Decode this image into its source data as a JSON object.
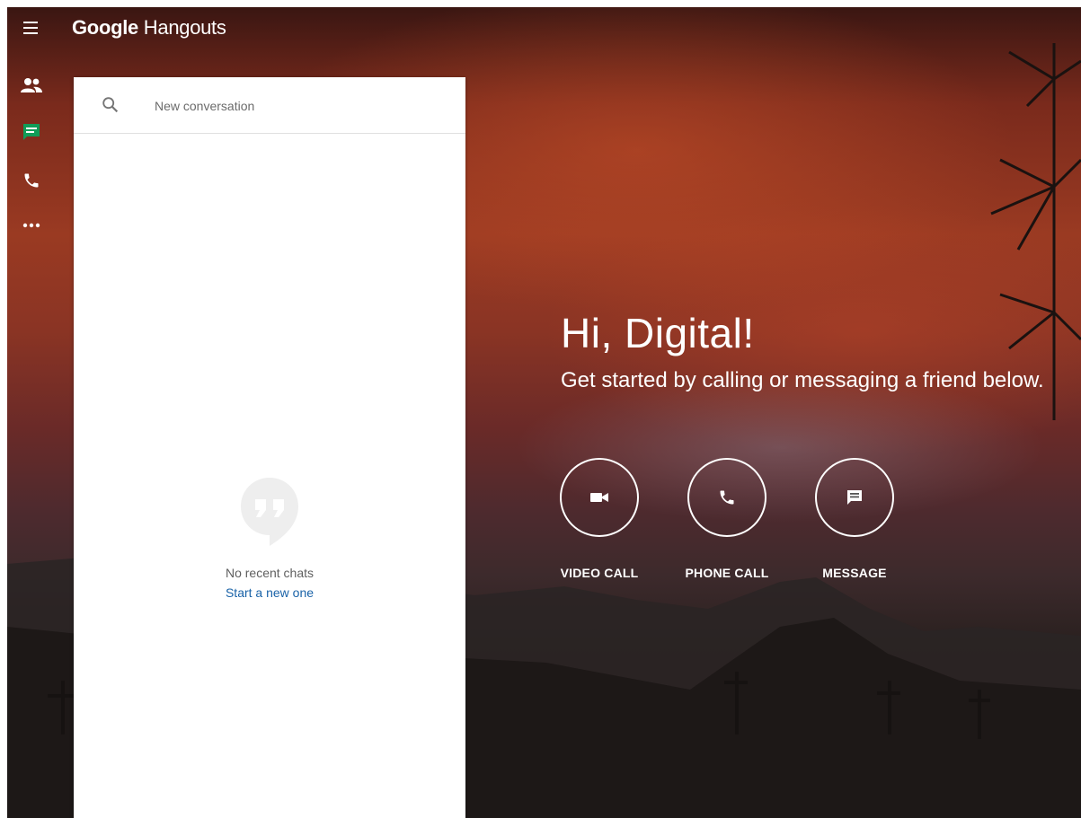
{
  "app": {
    "brand_google": "Google",
    "brand_product": "Hangouts"
  },
  "rail": {
    "items": [
      {
        "icon": "contacts-icon"
      },
      {
        "icon": "chat-icon",
        "active": true
      },
      {
        "icon": "phone-icon"
      },
      {
        "icon": "more-icon"
      }
    ],
    "active_color": "#0f9d58"
  },
  "search": {
    "placeholder": "New conversation",
    "value": ""
  },
  "empty_state": {
    "icon": "quote-bubble-icon",
    "text": "No recent chats",
    "link": "Start a new one"
  },
  "greeting": {
    "title": "Hi, Digital!",
    "subtitle": "Get started by calling or messaging a friend below."
  },
  "actions": [
    {
      "label": "VIDEO CALL",
      "icon": "video-camera-icon"
    },
    {
      "label": "PHONE CALL",
      "icon": "phone-icon"
    },
    {
      "label": "MESSAGE",
      "icon": "message-icon"
    }
  ],
  "colors": {
    "link": "#1a63a8",
    "panel_bg": "#ffffff"
  }
}
